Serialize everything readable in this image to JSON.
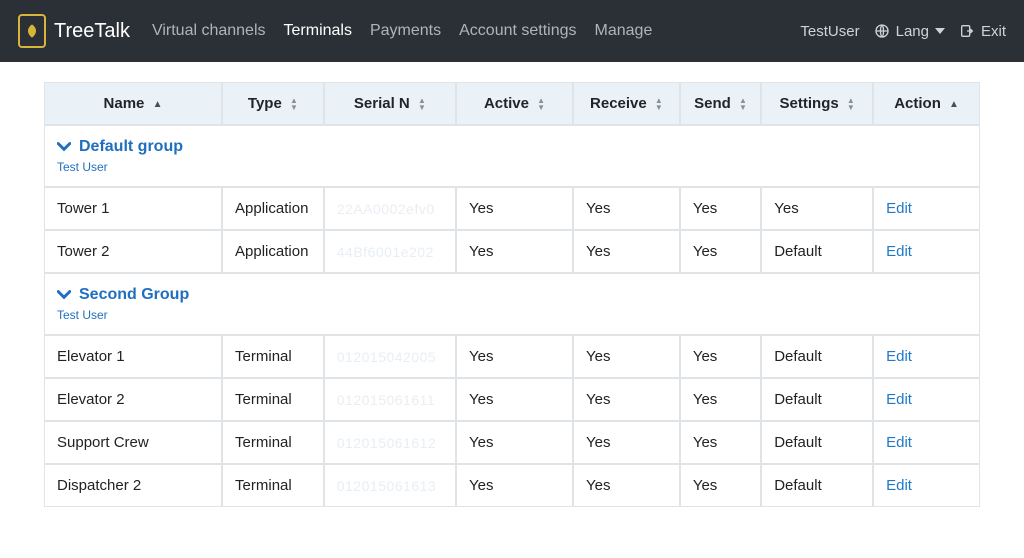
{
  "brand": {
    "name": "TreeTalk"
  },
  "nav": {
    "links": {
      "virtual_channels": "Virtual channels",
      "terminals": "Terminals",
      "payments": "Payments",
      "account_settings": "Account settings",
      "manage": "Manage"
    },
    "user": "TestUser",
    "lang_label": "Lang",
    "exit_label": "Exit"
  },
  "table": {
    "headers": {
      "name": "Name",
      "type": "Type",
      "serial": "Serial N",
      "active": "Active",
      "receive": "Receive",
      "send": "Send",
      "settings": "Settings",
      "action": "Action"
    }
  },
  "groups": {
    "g0": {
      "title": "Default group",
      "sub": "Test User"
    },
    "g1": {
      "title": "Second Group",
      "sub": "Test User"
    }
  },
  "rows": {
    "r0": {
      "name": "Tower 1",
      "type": "Application",
      "serial": "22AA0002efv0",
      "active": "Yes",
      "receive": "Yes",
      "send": "Yes",
      "settings": "Yes",
      "action": "Edit"
    },
    "r1": {
      "name": "Tower 2",
      "type": "Application",
      "serial": "44Bf6001e202",
      "active": "Yes",
      "receive": "Yes",
      "send": "Yes",
      "settings": "Default",
      "action": "Edit"
    },
    "r2": {
      "name": "Elevator 1",
      "type": "Terminal",
      "serial": "012015042005",
      "active": "Yes",
      "receive": "Yes",
      "send": "Yes",
      "settings": "Default",
      "action": "Edit"
    },
    "r3": {
      "name": "Elevator 2",
      "type": "Terminal",
      "serial": "012015061611",
      "active": "Yes",
      "receive": "Yes",
      "send": "Yes",
      "settings": "Default",
      "action": "Edit"
    },
    "r4": {
      "name": "Support Crew",
      "type": "Terminal",
      "serial": "012015061612",
      "active": "Yes",
      "receive": "Yes",
      "send": "Yes",
      "settings": "Default",
      "action": "Edit"
    },
    "r5": {
      "name": "Dispatcher 2",
      "type": "Terminal",
      "serial": "012015061613",
      "active": "Yes",
      "receive": "Yes",
      "send": "Yes",
      "settings": "Default",
      "action": "Edit"
    }
  }
}
